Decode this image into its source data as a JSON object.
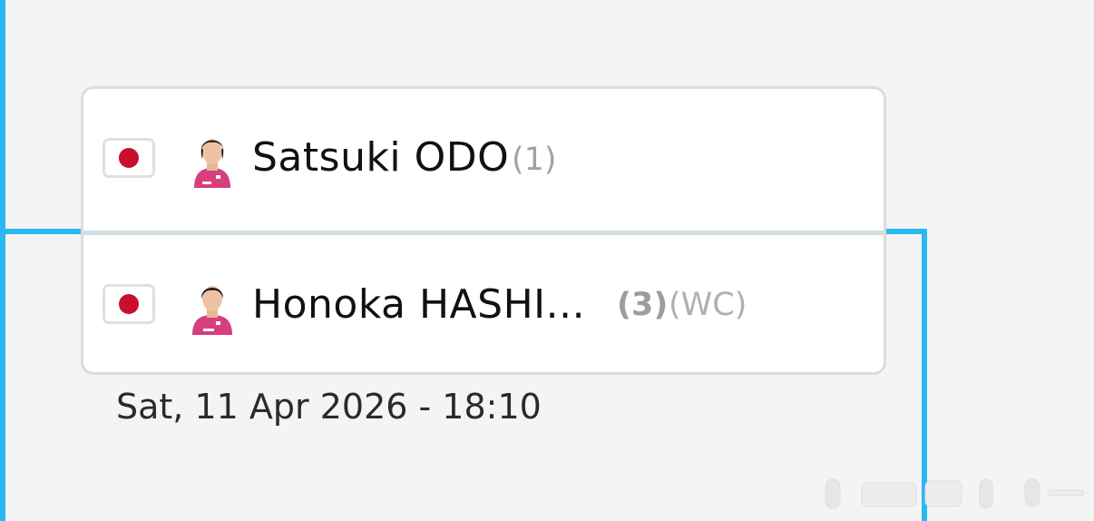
{
  "match": {
    "player1": {
      "name": "Satsuki ODO",
      "seed": "(1)",
      "flag_icon": "japan-flag-icon",
      "avatar_icon": "player-photo-icon"
    },
    "player2": {
      "name": "Honoka HASHI...",
      "seed": "(3)",
      "entry": "(WC)",
      "flag_icon": "japan-flag-icon",
      "avatar_icon": "player-photo-icon"
    },
    "datetime": "Sat, 11 Apr 2026 - 18:10"
  },
  "colors": {
    "bracket_line": "#2ab7f2",
    "flag_disc": "#c8102e",
    "jersey": "#d63f7c",
    "background": "#f4f4f4"
  }
}
